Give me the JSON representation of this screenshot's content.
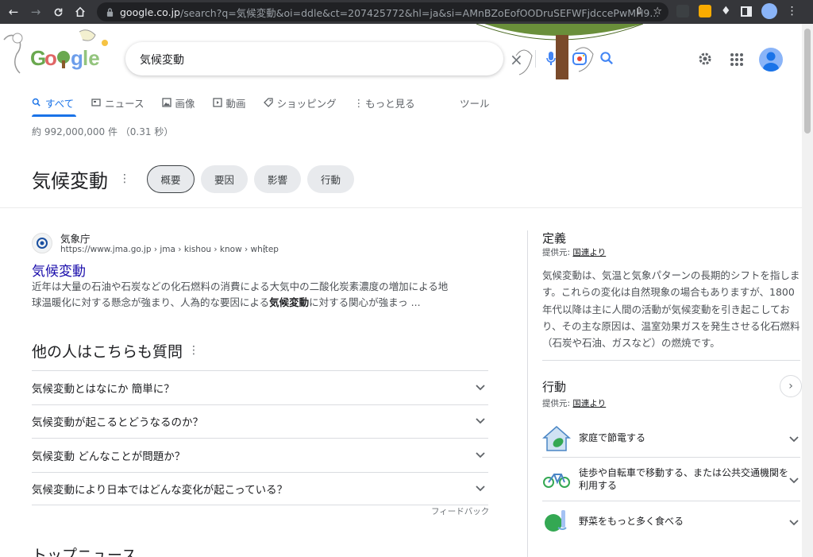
{
  "browser": {
    "url_host": "google.co.jp",
    "url_rest": "/search?q=気候変動&oi=ddle&ct=207425772&hl=ja&si=AMnBZoEofOODruSEFWFjdccePwMH9...",
    "icons": [
      "back-icon",
      "forward-icon",
      "reload-icon",
      "home-icon",
      "lock-icon",
      "share-icon",
      "star-icon",
      "extension-icon",
      "puzzle-icon",
      "sidepanel-icon",
      "profile-icon",
      "menu-icon"
    ]
  },
  "search": {
    "query": "気候変動"
  },
  "tabs": [
    {
      "label": "すべて",
      "icon": "search-icon"
    },
    {
      "label": "ニュース",
      "icon": "news-icon"
    },
    {
      "label": "画像",
      "icon": "image-icon"
    },
    {
      "label": "動画",
      "icon": "video-icon"
    },
    {
      "label": "ショッピング",
      "icon": "tag-icon"
    },
    {
      "label": "もっと見る",
      "icon": "more-icon"
    }
  ],
  "tools_label": "ツール",
  "stats": "約 992,000,000 件 （0.31 秒）",
  "topic": {
    "title": "気候変動",
    "chips": [
      "概要",
      "要因",
      "影響",
      "行動"
    ]
  },
  "result": {
    "site_name": "気象庁",
    "site_url": "https://www.jma.go.jp › jma › kishou › know › whitep",
    "title": "気候変動",
    "snippet_1": "近年は大量の石油や石炭などの化石燃料の消費による大気中の二酸化炭素濃度の増加による地球温暖化に対する懸念が強まり、人為的な要因による",
    "snippet_bold": "気候変動",
    "snippet_2": "に対する関心が強まっ ..."
  },
  "paa": {
    "title": "他の人はこちらも質問",
    "questions": [
      "気候変動とはなにか 簡単に？",
      "気候変動が起こるとどうなるのか？",
      "気候変動 どんなことが問題か？",
      "気候変動により日本ではどんな変化が起こっている？"
    ],
    "feedback": "フィードバック"
  },
  "top_news_title": "トップニュース",
  "panel": {
    "definition_title": "定義",
    "source_prefix": "提供元: ",
    "source_name": "国連より",
    "definition_text": "気候変動は、気温と気象パターンの長期的シフトを指します。これらの変化は自然現象の場合もありますが、1800 年代以降は主に人間の活動が気候変動を引き起こしており、その主な原因は、温室効果ガスを発生させる化石燃料（石炭や石油、ガスなど）の燃焼です。",
    "actions_title": "行動",
    "actions": [
      {
        "label": "家庭で節電する",
        "icon": "house-leaf-icon"
      },
      {
        "label": "徒歩や自転車で移動する、または公共交通機関を利用する",
        "icon": "bicycle-icon"
      },
      {
        "label": "野菜をもっと多く食べる",
        "icon": "vegetable-icon"
      }
    ]
  },
  "colors": {
    "link": "#1a0dab",
    "accent": "#1a73e8",
    "chrome": "#35363a"
  }
}
